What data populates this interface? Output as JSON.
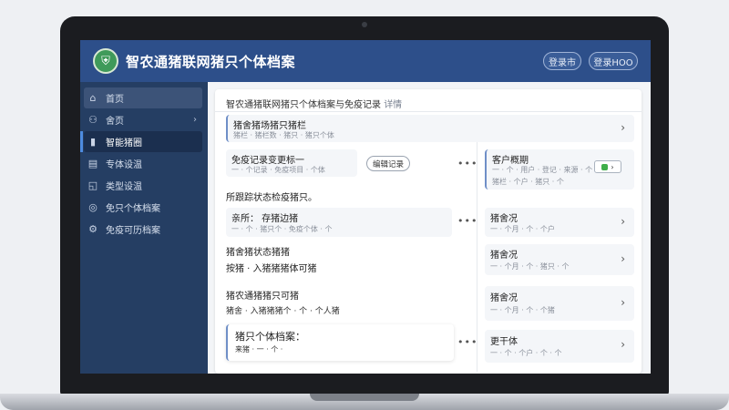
{
  "app": {
    "title": "智农通猪联网猪只个体档案",
    "logo_glyph": "⛨",
    "login_label": "登录市",
    "dept_label": "登录HOO"
  },
  "sidebar": {
    "items": [
      {
        "label": "首页",
        "icon": "home-icon",
        "glyph": "⌂"
      },
      {
        "label": "舍页",
        "icon": "users-icon",
        "glyph": "⚇",
        "chevron": "›"
      },
      {
        "label": "智能猪圈",
        "icon": "chart-bars-icon",
        "glyph": "▮"
      },
      {
        "label": "专体设温",
        "icon": "document-icon",
        "glyph": "▤"
      },
      {
        "label": "类型设温",
        "icon": "box-icon",
        "glyph": "◱"
      },
      {
        "label": "免只个体档案",
        "icon": "settings-circle-icon",
        "glyph": "◎"
      },
      {
        "label": "免疫可历档案",
        "icon": "gear-icon",
        "glyph": "⚙"
      }
    ]
  },
  "main": {
    "header_title": "智农通猪联网猪只个体档案与免疫记录",
    "header_sub": "详情",
    "cards": [
      {
        "title": "猪舍猪场猪只猪栏",
        "sub": "猪栏 · 猪栏数 · 猪只 · 猪只个体",
        "chev": "›"
      },
      {
        "title": "免疫记录变更标一",
        "sub": "一 · 个记录 · 免疫项目 · 个体",
        "button": "编辑记录",
        "dots": "•••"
      },
      {
        "title": "客户概期",
        "sub": "一 · 个 · 用户 · 登记 · 来源 · 个",
        "sub2": "猪栏 · 个户 · 猪只 · 个",
        "badge_arrow": "›"
      },
      {
        "title": "所跟踪状态检疫猪只。",
        "plain": true
      },
      {
        "title": "亲所：  存猪边猪",
        "sub": "一 · 个 · 猪只个 · 免疫个体 · 个",
        "dots": "•••"
      },
      {
        "title": "猪舍况",
        "sub": "一 · 个月 · 个 · 个户",
        "chev": "›"
      },
      {
        "title": "猪舍猪状态猪猪",
        "plain": true
      },
      {
        "title": "按猪 · 入猪猪猪体可猪",
        "plain": true
      },
      {
        "title": "猪舍况",
        "sub": "一 · 个月 · 个 · 猪只 · 个",
        "chev": "›"
      },
      {
        "title": "猪农通猪猪只可猪",
        "plain": true
      },
      {
        "title": "猪舍 · 入猪猪猪个 · 个 · 个人猪",
        "sub_plain": true
      },
      {
        "title": "猪舍况",
        "sub": "一 · 个月 · 个 · 个猪",
        "chev": "›"
      },
      {
        "title": "猪只个体档案：",
        "sub": "来猪 · 一 · 个 ·",
        "dots": "•••"
      },
      {
        "title": "更干体",
        "sub": "一 · 个 · 个户 · 个 · 个",
        "chev": "›"
      }
    ]
  }
}
